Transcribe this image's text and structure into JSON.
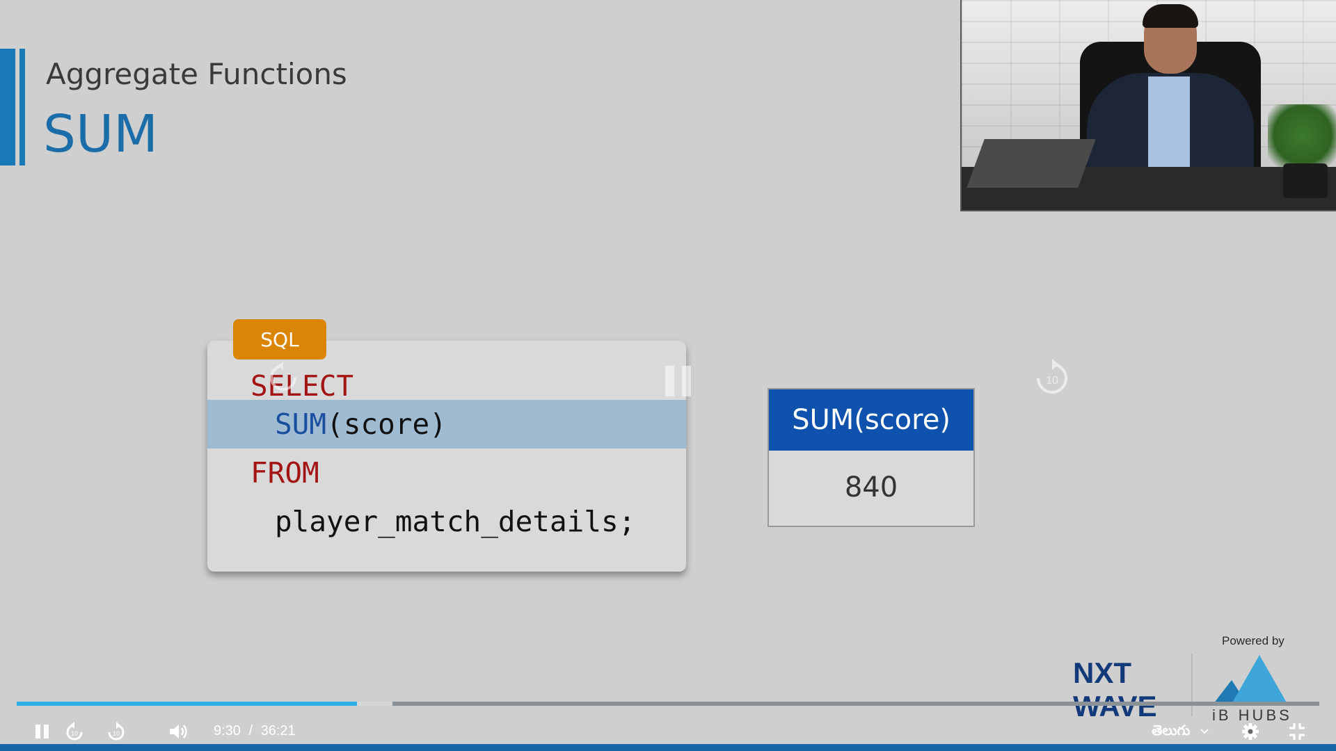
{
  "slide": {
    "subtitle": "Aggregate Functions",
    "title": "SUM",
    "sql_tag": "SQL",
    "code": {
      "line1": "SELECT",
      "line2_fn": "SUM",
      "line2_rest": "(score)",
      "line3": "FROM",
      "line4": "player_match_details;"
    },
    "result": {
      "header": "SUM(score)",
      "value": "840"
    }
  },
  "branding": {
    "powered_by": "Powered by",
    "nxt_line1": "NXT",
    "nxt_line2": "WAVE",
    "ib_hubs": "iB HUBS"
  },
  "player": {
    "current_time": "9:30",
    "separator": "/",
    "duration": "36:21",
    "progress_fraction": 0.2612,
    "buffered_fraction": 0.2887,
    "language": "తెలుగు",
    "rewind_seconds": "10",
    "forward_seconds": "10",
    "accent": "#2db0e6"
  },
  "icons": [
    "pause-icon",
    "rewind-10-icon",
    "forward-10-icon",
    "volume-icon",
    "chevron-down-icon",
    "gear-icon",
    "exit-fullscreen-icon"
  ]
}
